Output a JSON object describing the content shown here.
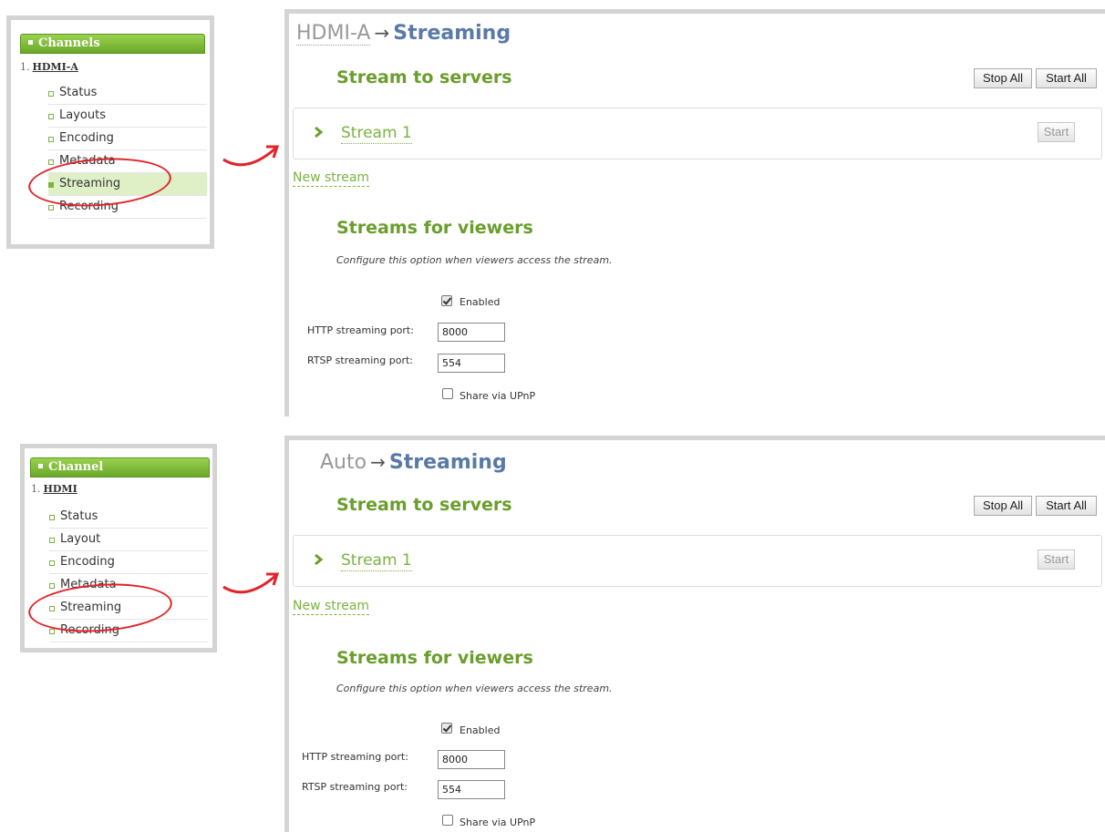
{
  "colors": {
    "accent_green": "#7ab342",
    "title_blue": "#5a7aa6",
    "highlight_red": "#e0242a"
  },
  "top": {
    "menu": {
      "header": "Channels",
      "channel_num": "1.",
      "channel_name": "HDMI-A",
      "items": [
        "Status",
        "Layouts",
        "Encoding",
        "Metadata",
        "Streaming",
        "Recording"
      ],
      "active": "Streaming"
    },
    "panel": {
      "channel": "HDMI-A",
      "arrow": "→",
      "section": "Streaming",
      "stream_to_servers": "Stream to servers",
      "stop_all": "Stop All",
      "start_all": "Start All",
      "stream_name": "Stream 1",
      "start": "Start",
      "new_stream": "New stream",
      "streams_for_viewers": "Streams for viewers",
      "description": "Configure this option when viewers access the stream.",
      "enabled_label": "Enabled",
      "enabled": true,
      "http_label": "HTTP streaming port:",
      "http_port": "8000",
      "rtsp_label": "RTSP streaming port:",
      "rtsp_port": "554",
      "upnp_label": "Share via UPnP",
      "upnp": false
    }
  },
  "bottom": {
    "menu": {
      "header": "Channel",
      "channel_num": "1.",
      "channel_name": "HDMI",
      "items": [
        "Status",
        "Layout",
        "Encoding",
        "Metadata",
        "Streaming",
        "Recording"
      ],
      "active": ""
    },
    "panel": {
      "channel": "Auto",
      "arrow": "→",
      "section": "Streaming",
      "stream_to_servers": "Stream to servers",
      "stop_all": "Stop All",
      "start_all": "Start All",
      "stream_name": "Stream 1",
      "start": "Start",
      "new_stream": "New stream",
      "streams_for_viewers": "Streams for viewers",
      "description": "Configure this option when viewers access the stream.",
      "enabled_label": "Enabled",
      "enabled": true,
      "http_label": "HTTP streaming port:",
      "http_port": "8000",
      "rtsp_label": "RTSP streaming port:",
      "rtsp_port": "554",
      "upnp_label": "Share via UPnP",
      "upnp": false
    }
  }
}
